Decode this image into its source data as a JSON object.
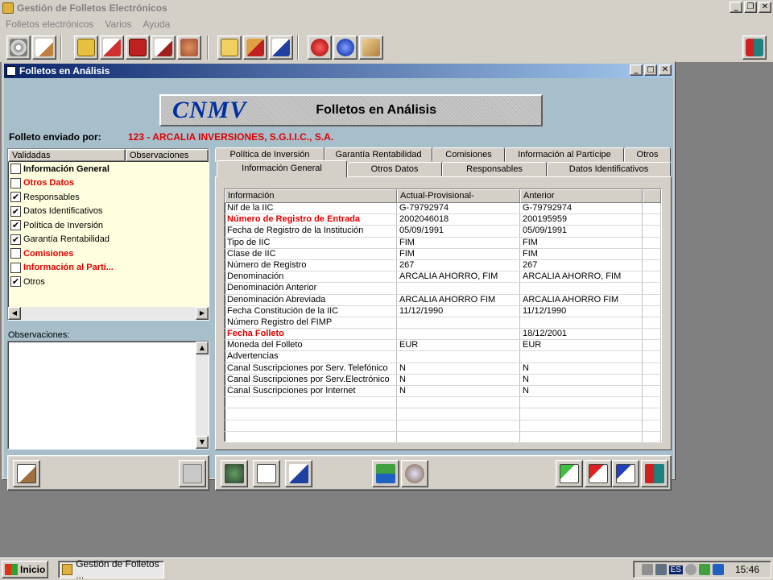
{
  "app": {
    "title": "Gestión de Folletos Electrónicos"
  },
  "menu": [
    "Folletos electrónicos",
    "Varios",
    "Ayuda"
  ],
  "window": {
    "title": "Folletos en Análisis"
  },
  "banner": {
    "logo": "CNMV",
    "subtitle": "Folletos en Análisis"
  },
  "sender": {
    "label": "Folleto enviado por:",
    "value": "123 - ARCALIA INVERSIONES, S.G.I.I.C., S.A."
  },
  "left_list": {
    "columns": [
      "Validadas",
      "Observaciones"
    ],
    "items": [
      {
        "label": "Información General",
        "checked": false,
        "style": "bold"
      },
      {
        "label": "Otros Datos",
        "checked": false,
        "style": "red"
      },
      {
        "label": "Responsables",
        "checked": true,
        "style": ""
      },
      {
        "label": "Datos Identificativos",
        "checked": true,
        "style": ""
      },
      {
        "label": "Política de Inversión",
        "checked": true,
        "style": ""
      },
      {
        "label": "Garantía Rentabilidad",
        "checked": true,
        "style": ""
      },
      {
        "label": "Comisiones",
        "checked": false,
        "style": "red"
      },
      {
        "label": "Información al Partí...",
        "checked": false,
        "style": "red"
      },
      {
        "label": "Otros",
        "checked": true,
        "style": ""
      }
    ]
  },
  "observations": {
    "label": "Observaciones:",
    "value": ""
  },
  "tabs_back": [
    "Política de Inversión",
    "Garantía Rentabilidad",
    "Comisiones",
    "Información al Partícipe",
    "Otros"
  ],
  "tabs_front": [
    "Información General",
    "Otros Datos",
    "Responsables",
    "Datos Identificativos"
  ],
  "active_tab": "Información General",
  "grid": {
    "columns": [
      "Información",
      "Actual-Provisional-",
      "Anterior"
    ],
    "rows": [
      {
        "info": "Nif de la IIC",
        "actual": "G-79792974",
        "anterior": "G-79792974",
        "hl": false
      },
      {
        "info": "Número de Registro de Entrada",
        "actual": "2002046018",
        "anterior": "200195959",
        "hl": true
      },
      {
        "info": "Fecha de Registro de la Institución",
        "actual": "05/09/1991",
        "anterior": "05/09/1991",
        "hl": false
      },
      {
        "info": "Tipo de IIC",
        "actual": "FIM",
        "anterior": "FIM",
        "hl": false
      },
      {
        "info": "Clase de IIC",
        "actual": "FIM",
        "anterior": "FIM",
        "hl": false
      },
      {
        "info": "Número de Registro",
        "actual": "267",
        "anterior": "267",
        "hl": false
      },
      {
        "info": "Denominación",
        "actual": "ARCALIA AHORRO, FIM",
        "anterior": "ARCALIA AHORRO, FIM",
        "hl": false
      },
      {
        "info": "Denominación Anterior",
        "actual": "",
        "anterior": "",
        "hl": false
      },
      {
        "info": "Denominación Abreviada",
        "actual": "ARCALIA AHORRO FIM",
        "anterior": "ARCALIA AHORRO FIM",
        "hl": false
      },
      {
        "info": "Fecha Constitución de la IIC",
        "actual": "11/12/1990",
        "anterior": "11/12/1990",
        "hl": false
      },
      {
        "info": "Número Registro del FIMP",
        "actual": "",
        "anterior": "",
        "hl": false
      },
      {
        "info": "Fecha Folleto",
        "actual": "",
        "anterior": "18/12/2001",
        "hl": true
      },
      {
        "info": "Moneda del Folleto",
        "actual": "EUR",
        "anterior": "EUR",
        "hl": false
      },
      {
        "info": "Advertencias",
        "actual": "",
        "anterior": "",
        "hl": false
      },
      {
        "info": "Canal Suscripciones por Serv. Telefónico",
        "actual": "N",
        "anterior": "N",
        "hl": false
      },
      {
        "info": "Canal Suscripciones por Serv.Electrónico",
        "actual": "N",
        "anterior": "N",
        "hl": false
      },
      {
        "info": "Canal Suscripciones por Internet",
        "actual": "N",
        "anterior": "N",
        "hl": false
      }
    ]
  },
  "taskbar": {
    "start": "Inicio",
    "task": "Gestión de Folletos ...",
    "lang": "ES",
    "clock": "15:46"
  }
}
